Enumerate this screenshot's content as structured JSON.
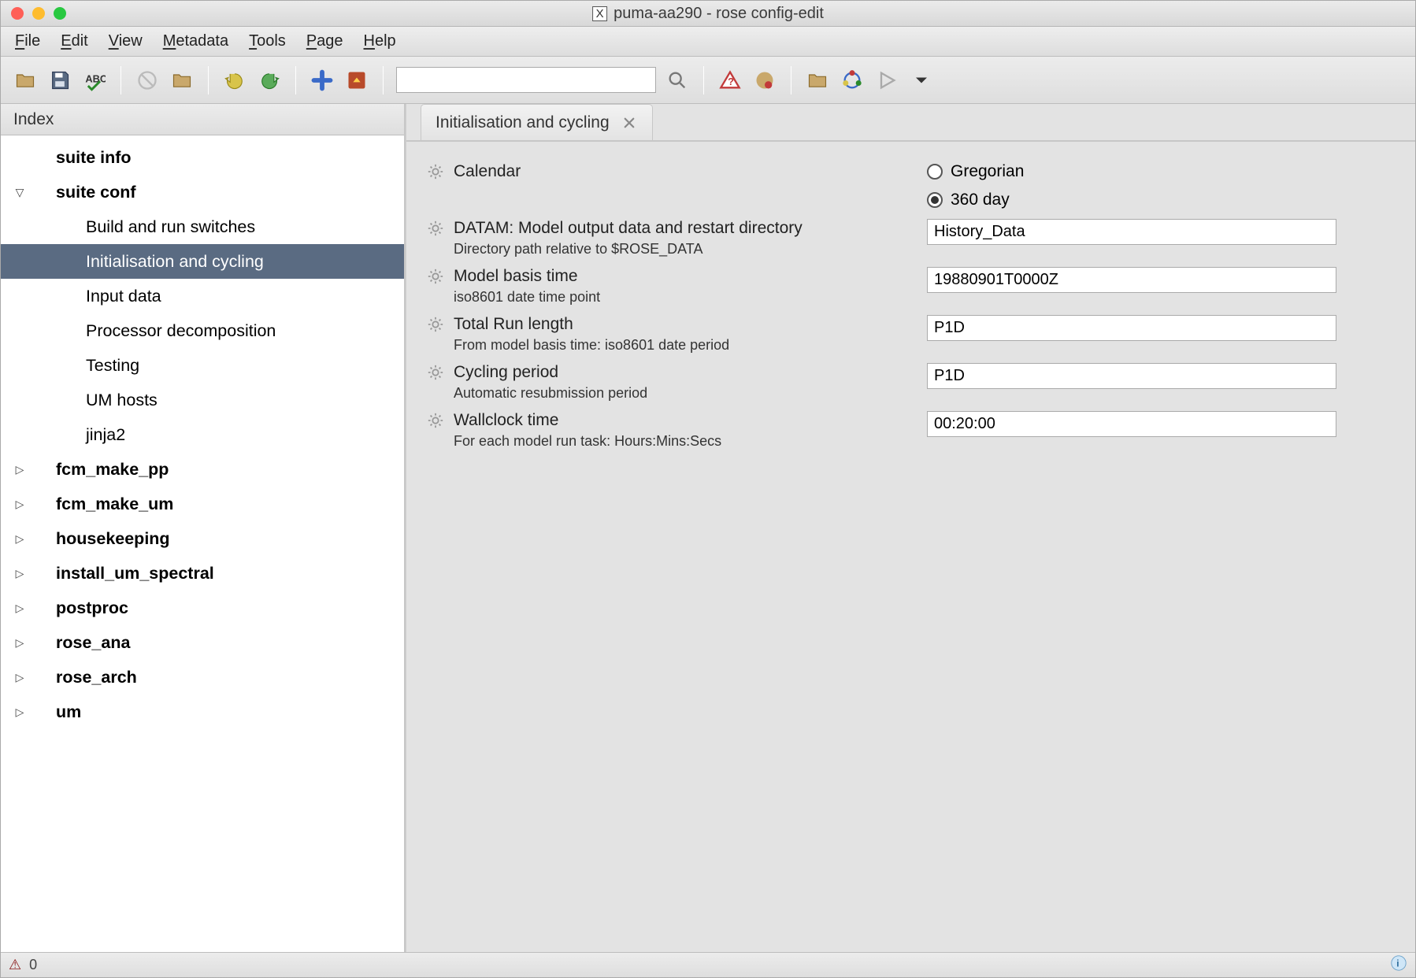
{
  "window": {
    "title": "puma-aa290 - rose config-edit"
  },
  "menubar": [
    "File",
    "Edit",
    "View",
    "Metadata",
    "Tools",
    "Page",
    "Help"
  ],
  "sidebar": {
    "header": "Index",
    "items": [
      {
        "label": "suite info",
        "bold": true,
        "expander": "",
        "indent": 1
      },
      {
        "label": "suite conf",
        "bold": true,
        "expander": "▽",
        "indent": 1
      },
      {
        "label": "Build and run switches",
        "bold": false,
        "expander": "",
        "indent": 2
      },
      {
        "label": "Initialisation and cycling",
        "bold": false,
        "expander": "",
        "indent": 2,
        "selected": true
      },
      {
        "label": "Input data",
        "bold": false,
        "expander": "",
        "indent": 2
      },
      {
        "label": "Processor decomposition",
        "bold": false,
        "expander": "",
        "indent": 2
      },
      {
        "label": "Testing",
        "bold": false,
        "expander": "",
        "indent": 2
      },
      {
        "label": "UM hosts",
        "bold": false,
        "expander": "",
        "indent": 2
      },
      {
        "label": "jinja2",
        "bold": false,
        "expander": "",
        "indent": 2
      },
      {
        "label": "fcm_make_pp",
        "bold": true,
        "expander": "▷",
        "indent": 1
      },
      {
        "label": "fcm_make_um",
        "bold": true,
        "expander": "▷",
        "indent": 1
      },
      {
        "label": "housekeeping",
        "bold": true,
        "expander": "▷",
        "indent": 1
      },
      {
        "label": "install_um_spectral",
        "bold": true,
        "expander": "▷",
        "indent": 1
      },
      {
        "label": "postproc",
        "bold": true,
        "expander": "▷",
        "indent": 1
      },
      {
        "label": "rose_ana",
        "bold": true,
        "expander": "▷",
        "indent": 1
      },
      {
        "label": "rose_arch",
        "bold": true,
        "expander": "▷",
        "indent": 1
      },
      {
        "label": "um",
        "bold": true,
        "expander": "▷",
        "indent": 1
      }
    ]
  },
  "main": {
    "tab_title": "Initialisation and cycling",
    "calendar": {
      "label": "Calendar",
      "options": [
        "Gregorian",
        "360 day"
      ],
      "selected": "360 day"
    },
    "datam": {
      "label": "DATAM: Model output data and restart directory",
      "help": "Directory path relative to $ROSE_DATA",
      "value": "History_Data"
    },
    "basis": {
      "label": "Model basis time",
      "help": "iso8601 date time point",
      "value": "19880901T0000Z"
    },
    "runlen": {
      "label": "Total Run length",
      "help": "From model basis time: iso8601 date period",
      "value": "P1D"
    },
    "cycle": {
      "label": "Cycling period",
      "help": "Automatic resubmission period",
      "value": "P1D"
    },
    "wall": {
      "label": "Wallclock time",
      "help": "For each model run task: Hours:Mins:Secs",
      "value": "00:20:00"
    }
  },
  "status": {
    "count": "0"
  }
}
